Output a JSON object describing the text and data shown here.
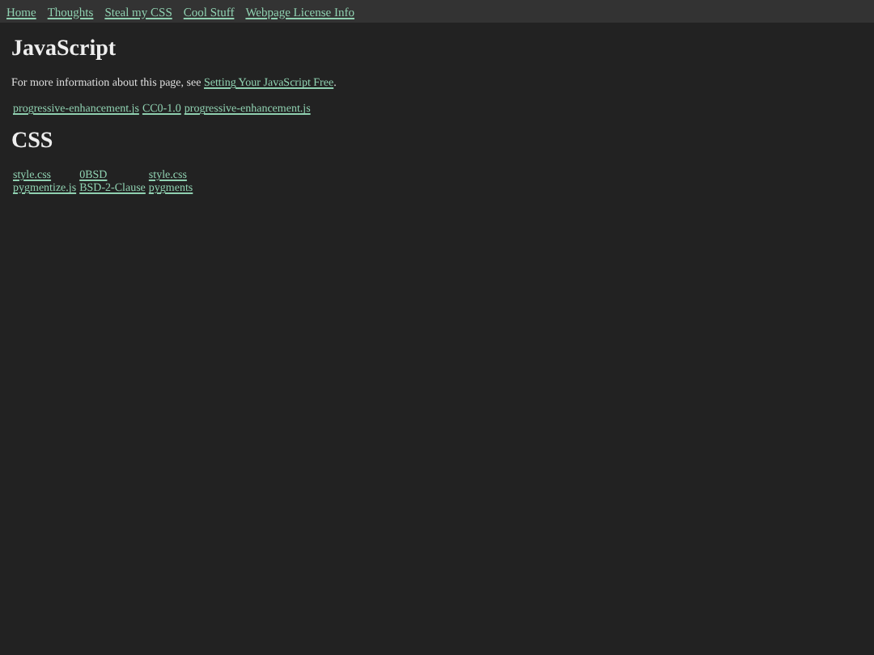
{
  "nav": [
    {
      "label": "Home"
    },
    {
      "label": "Thoughts"
    },
    {
      "label": "Steal my CSS"
    },
    {
      "label": "Cool Stuff"
    },
    {
      "label": "Webpage License Info"
    }
  ],
  "sections": [
    {
      "heading": "JavaScript",
      "intro": {
        "text": "For more information about this page, see ",
        "link": "Setting Your JavaScript Free",
        "after": "."
      },
      "rows": [
        [
          "progressive-enhancement.js",
          "CC0-1.0",
          "progressive-enhancement.js"
        ]
      ]
    },
    {
      "heading": "CSS",
      "rows": [
        [
          "style.css",
          "0BSD",
          "style.css"
        ],
        [
          "pygmentize.js",
          "BSD-2-Clause",
          "pygments"
        ]
      ]
    }
  ]
}
